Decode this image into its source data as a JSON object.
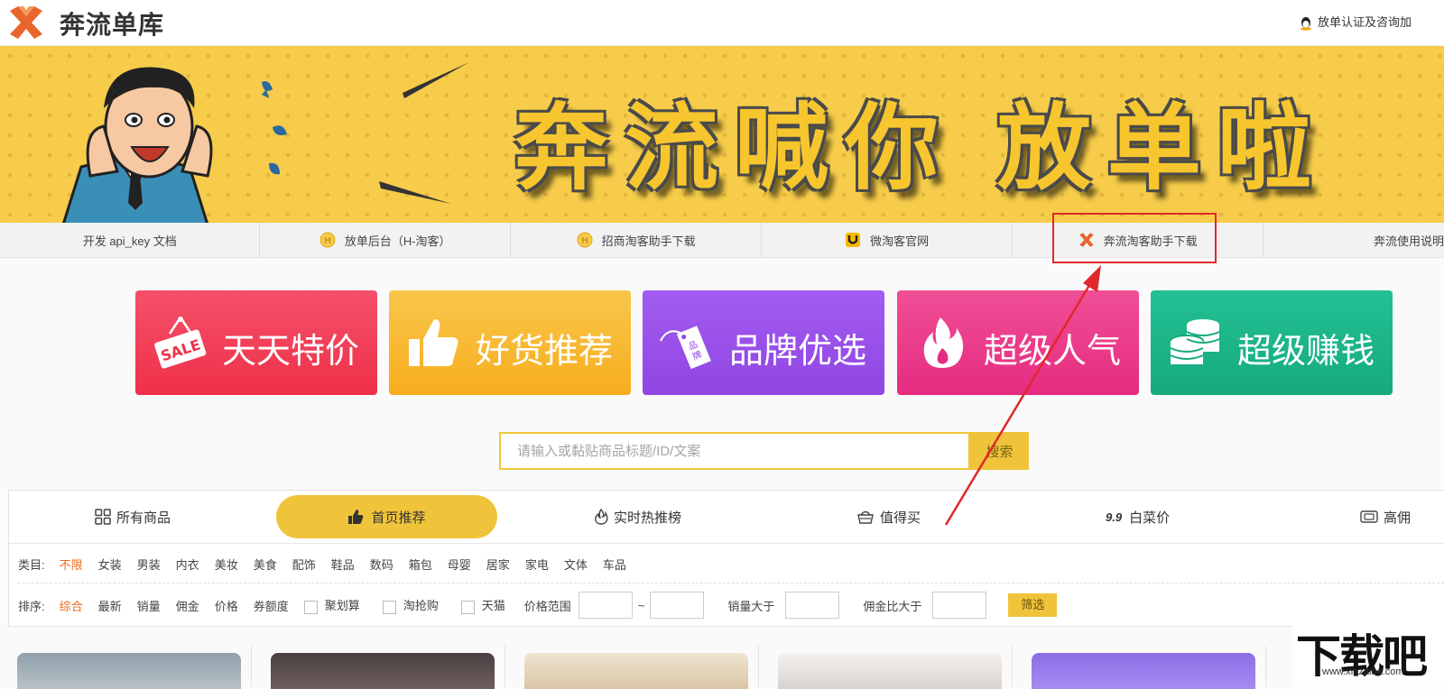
{
  "header": {
    "site_name": "奔流单库",
    "right_link": "放单认证及咨询加"
  },
  "banner": {
    "slogan": "奔流喊你 放单啦"
  },
  "quick_nav": [
    {
      "label": "开发 api_key 文档",
      "icon": ""
    },
    {
      "label": "放单后台（H-淘客）",
      "icon": "coin-icon"
    },
    {
      "label": "招商淘客助手下载",
      "icon": "coin-icon"
    },
    {
      "label": "微淘客官网",
      "icon": "u-magnet-icon"
    },
    {
      "label": "奔流淘客助手下载",
      "icon": "benliu-logo-icon"
    },
    {
      "label": "奔流使用说明",
      "icon": ""
    }
  ],
  "cards": [
    {
      "label": "天天特价",
      "icon": "sale-sign-icon",
      "color": "#f0405a"
    },
    {
      "label": "好货推荐",
      "icon": "thumbs-up-icon",
      "color": "#f8b52c"
    },
    {
      "label": "品牌优选",
      "icon": "brand-tag-icon",
      "color": "#9b4de8"
    },
    {
      "label": "超级人气",
      "icon": "flame-icon",
      "color": "#ec3d8c"
    },
    {
      "label": "超级赚钱",
      "icon": "coins-stack-icon",
      "color": "#1fb88c"
    }
  ],
  "search": {
    "placeholder": "请输入或黏贴商品标题/ID/文案",
    "button": "搜索"
  },
  "tabs": [
    {
      "label": "所有商品",
      "icon": "grid-icon"
    },
    {
      "label": "首页推荐",
      "icon": "thumb-icon",
      "active": true
    },
    {
      "label": "实时热推榜",
      "icon": "fire-icon"
    },
    {
      "label": "值得买",
      "icon": "basket-icon"
    },
    {
      "label": "白菜价",
      "icon": "nine-nine-icon",
      "prefix": "9.9"
    },
    {
      "label": "高佣",
      "icon": "wallet-icon"
    }
  ],
  "category_filter": {
    "key": "类目:",
    "items": [
      "不限",
      "女装",
      "男装",
      "内衣",
      "美妆",
      "美食",
      "配饰",
      "鞋品",
      "数码",
      "箱包",
      "母婴",
      "居家",
      "家电",
      "文体",
      "车品"
    ],
    "selected": "不限"
  },
  "sort_filter": {
    "key": "排序:",
    "items": [
      "综合",
      "最新",
      "销量",
      "佣金",
      "价格",
      "券额度"
    ],
    "selected": "综合",
    "checkboxes": [
      "聚划算",
      "淘抢购",
      "天猫"
    ],
    "price_range_label": "价格范围",
    "range_sep": "~",
    "sales_label": "销量大于",
    "commission_label": "佣金比大于",
    "filter_button": "筛选"
  },
  "watermark": {
    "main": "下载吧",
    "url": "www.xiazaiba.com"
  },
  "colors": {
    "accent": "#f0c43a",
    "selected_text": "#e86a1c",
    "highlight_box": "#e0282c",
    "annotation_arrow": "#e0282c"
  }
}
